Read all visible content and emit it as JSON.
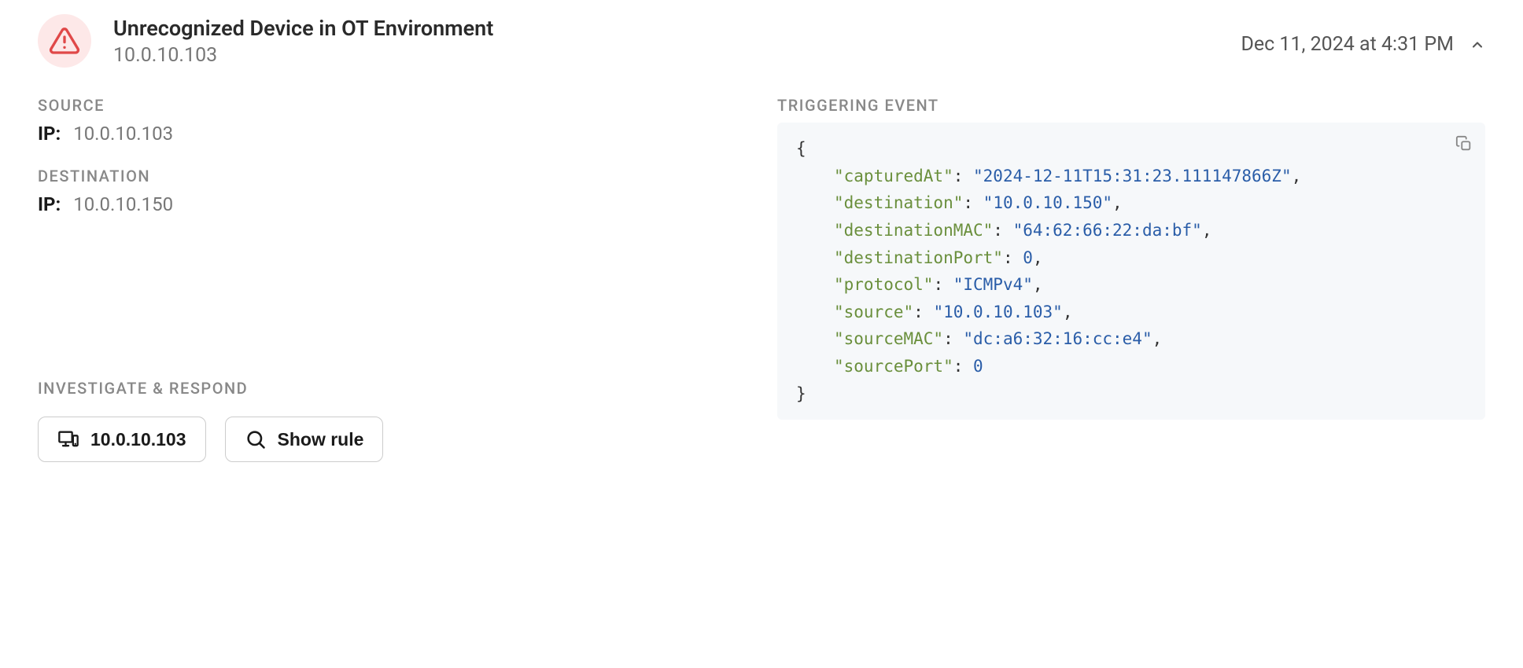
{
  "header": {
    "title": "Unrecognized Device in OT Environment",
    "subtitle": "10.0.10.103",
    "timestamp": "Dec 11, 2024 at 4:31 PM"
  },
  "source": {
    "label": "SOURCE",
    "ip_label": "IP:",
    "ip": "10.0.10.103"
  },
  "destination": {
    "label": "DESTINATION",
    "ip_label": "IP:",
    "ip": "10.0.10.150"
  },
  "triggering_event": {
    "label": "TRIGGERING EVENT",
    "fields": [
      {
        "key": "capturedAt",
        "value": "2024-12-11T15:31:23.111147866Z",
        "type": "string"
      },
      {
        "key": "destination",
        "value": "10.0.10.150",
        "type": "string"
      },
      {
        "key": "destinationMAC",
        "value": "64:62:66:22:da:bf",
        "type": "string"
      },
      {
        "key": "destinationPort",
        "value": 0,
        "type": "number"
      },
      {
        "key": "protocol",
        "value": "ICMPv4",
        "type": "string"
      },
      {
        "key": "source",
        "value": "10.0.10.103",
        "type": "string"
      },
      {
        "key": "sourceMAC",
        "value": "dc:a6:32:16:cc:e4",
        "type": "string"
      },
      {
        "key": "sourcePort",
        "value": 0,
        "type": "number"
      }
    ]
  },
  "respond": {
    "label": "INVESTIGATE & RESPOND",
    "device_button": "10.0.10.103",
    "show_rule_button": "Show rule"
  }
}
